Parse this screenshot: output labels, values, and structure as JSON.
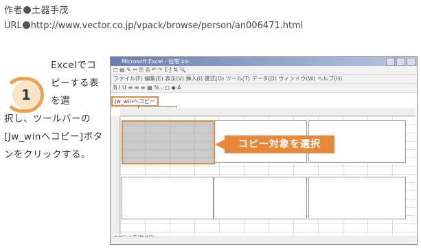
{
  "header": {
    "author_label": "作者",
    "author_name": "土器手茂",
    "url_label": "URL",
    "url": "http://www.vector.co.jp/vpack/browse/person/an006471.html"
  },
  "step": {
    "number": "1",
    "text_part1": "Excelでコピーする表を選",
    "text_part2": "択し、ツールバーの[Jw_winへコピー]ボタンをクリックする。"
  },
  "screenshot": {
    "window_title": "Microsoft Excel - 住宅.xls",
    "menu_items": [
      "ファイル(F)",
      "編集(E)",
      "表示(V)",
      "挿入(I)",
      "書式(O)",
      "ツール(T)",
      "データ(D)",
      "ウィンドウ(W)",
      "ヘルプ(H)"
    ],
    "jw_button_label": "Jw_winへコピー",
    "tooltip": "Jw_winへコピー",
    "callout": "コピー対象を選択",
    "sheet_tab": "内部仕上表(数値図)",
    "accent_color": "#e8893a"
  }
}
